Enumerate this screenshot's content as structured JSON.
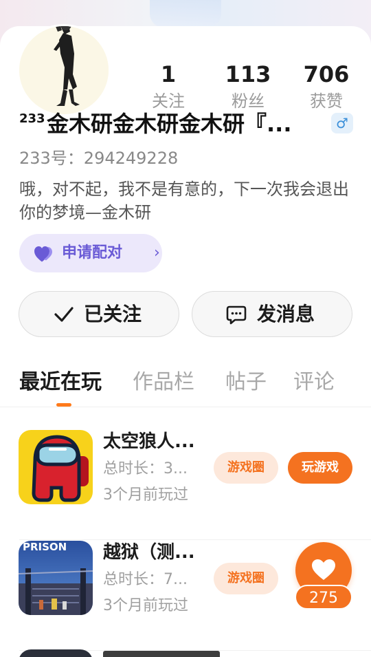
{
  "profile": {
    "name_superscript": "233",
    "name": "金木研金木研金木研『...",
    "gender_symbol": "♂",
    "uid": "233号：294249228",
    "bio": "哦，对不起，我不是有意的，下一次我会退出你的梦境—金木研",
    "pair_label": "申请配对",
    "pair_chevron": "›"
  },
  "stats": [
    {
      "value": "1",
      "label": "关注"
    },
    {
      "value": "113",
      "label": "粉丝"
    },
    {
      "value": "706",
      "label": "获赞"
    }
  ],
  "actions": {
    "follow_label": "已关注",
    "message_label": "发消息"
  },
  "tabs": [
    {
      "label": "最近在玩",
      "active": true
    },
    {
      "label": "作品栏",
      "active": false
    },
    {
      "label": "帖子",
      "active": false
    },
    {
      "label": "评论",
      "active": false
    }
  ],
  "games": [
    {
      "title": "太空狼人...",
      "duration": "总时长：3...",
      "last_played": "3个月前玩过",
      "circle_label": "游戏圈",
      "play_label": "玩游戏"
    },
    {
      "title": "越狱（测...",
      "duration": "总时长：7...",
      "last_played": "3个月前玩过",
      "circle_label": "游戏圈",
      "icon_text": "PRISON"
    }
  ],
  "floating_like": {
    "count": "275"
  },
  "colors": {
    "accent": "#f47220",
    "pair_purple": "#6a5bd6",
    "pair_bg": "#ece8fb",
    "gender_blue": "#3a8fd9"
  },
  "icons": {
    "follow": "check-icon",
    "message": "chat-bubble-icon",
    "pair": "hearts-icon",
    "like": "heart-icon"
  }
}
